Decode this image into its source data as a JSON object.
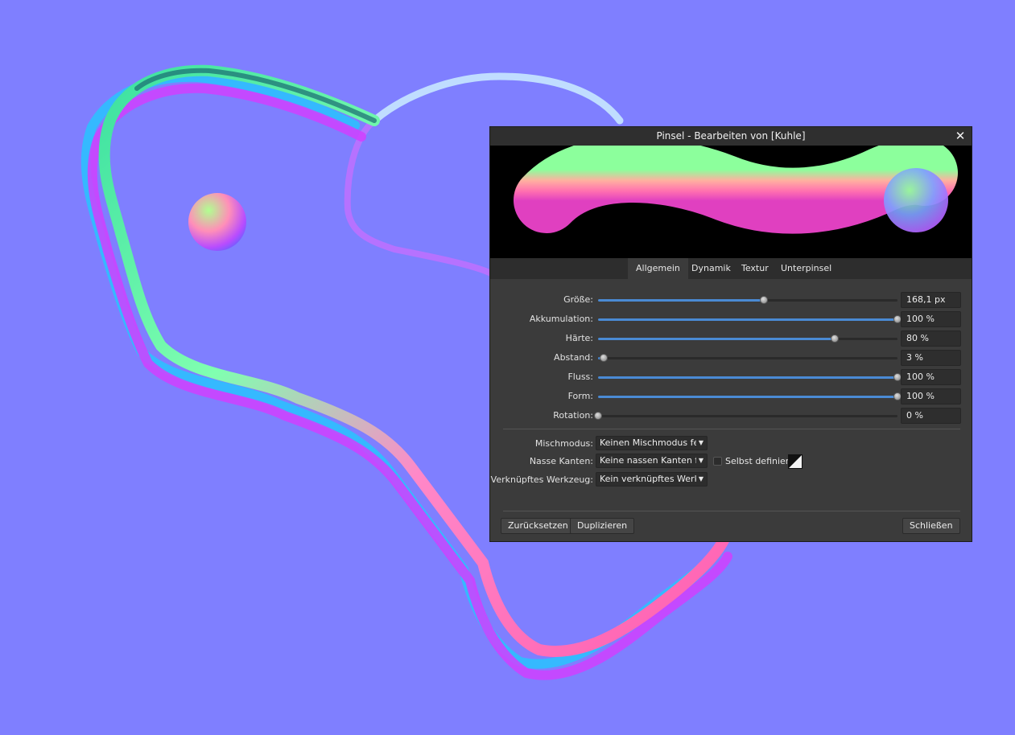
{
  "dialog": {
    "title": "Pinsel - Bearbeiten von [Kuhle]",
    "close_glyph": "✕",
    "tabs": [
      {
        "label": "Allgemein",
        "active": true
      },
      {
        "label": "Dynamik",
        "active": false
      },
      {
        "label": "Textur",
        "active": false
      },
      {
        "label": "Unterpinsel",
        "active": false
      }
    ],
    "params": [
      {
        "label": "Größe:",
        "value": "168,1 px",
        "level": 0.555
      },
      {
        "label": "Akkumulation:",
        "value": "100 %",
        "level": 1.0
      },
      {
        "label": "Härte:",
        "value": "80 %",
        "level": 0.79
      },
      {
        "label": "Abstand:",
        "value": "3 %",
        "level": 0.02
      },
      {
        "label": "Fluss:",
        "value": "100 %",
        "level": 1.0
      },
      {
        "label": "Form:",
        "value": "100 %",
        "level": 1.0
      },
      {
        "label": "Rotation:",
        "value": "0 %",
        "level": 0.0
      }
    ],
    "blend_mode": {
      "label": "Mischmodus:",
      "value": "Keinen Mischmodus festl"
    },
    "wet_edges": {
      "label": "Nasse Kanten:",
      "value": "Keine nassen Kanten fest",
      "custom_label": "Selbst definiert",
      "custom_checked": false
    },
    "linked_tool": {
      "label": "Verknüpftes Werkzeug:",
      "value": "Kein verknüpftes Werkze"
    },
    "buttons": {
      "reset": "Zurücksetzen",
      "duplicate": "Duplizieren",
      "close": "Schließen"
    }
  },
  "colors": {
    "canvas_bg": "#7f7fff",
    "dialog_bg": "#3b3b3b",
    "slider_fill": "#4a8ad4"
  }
}
